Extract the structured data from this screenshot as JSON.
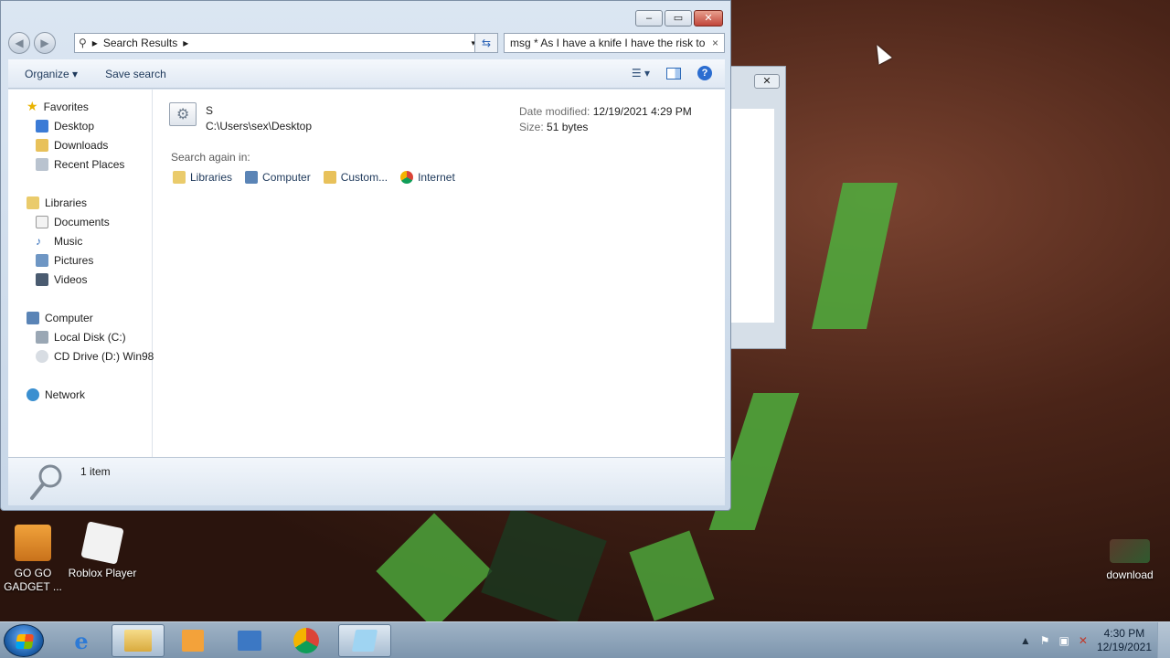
{
  "window": {
    "address": {
      "crumb": "Search Results",
      "arrows": [
        "▸",
        "▸"
      ],
      "dropdown": "▾"
    },
    "search_query": "msg * As I have a knife I have the risk to",
    "search_clear": "×",
    "captions": {
      "min": "–",
      "max": "▭",
      "close": "✕"
    },
    "toolbar": {
      "organize": "Organize ▾",
      "save_search": "Save search",
      "help": "?"
    },
    "sidebar": {
      "favorites": "Favorites",
      "fav_items": [
        "Desktop",
        "Downloads",
        "Recent Places"
      ],
      "libraries": "Libraries",
      "lib_items": [
        "Documents",
        "Music",
        "Pictures",
        "Videos"
      ],
      "computer": "Computer",
      "comp_items": [
        "Local Disk (C:)",
        "CD Drive (D:) Win98"
      ],
      "network": "Network"
    },
    "result": {
      "name": "S",
      "path": "C:\\Users\\sex\\Desktop",
      "date_label": "Date modified:",
      "date_value": "12/19/2021 4:29 PM",
      "size_label": "Size:",
      "size_value": "51 bytes"
    },
    "search_again": {
      "title": "Search again in:",
      "items": [
        "Libraries",
        "Computer",
        "Custom...",
        "Internet"
      ]
    },
    "details": {
      "count": "1 item"
    }
  },
  "desktop_icons": {
    "gogo": "GO GO GADGET ...",
    "roblox": "Roblox Player",
    "download": "download"
  },
  "taskbar": {
    "time": "4:30 PM",
    "date": "12/19/2021"
  },
  "colors": {
    "accent": "#2b6dd0",
    "close": "#c0453a"
  }
}
